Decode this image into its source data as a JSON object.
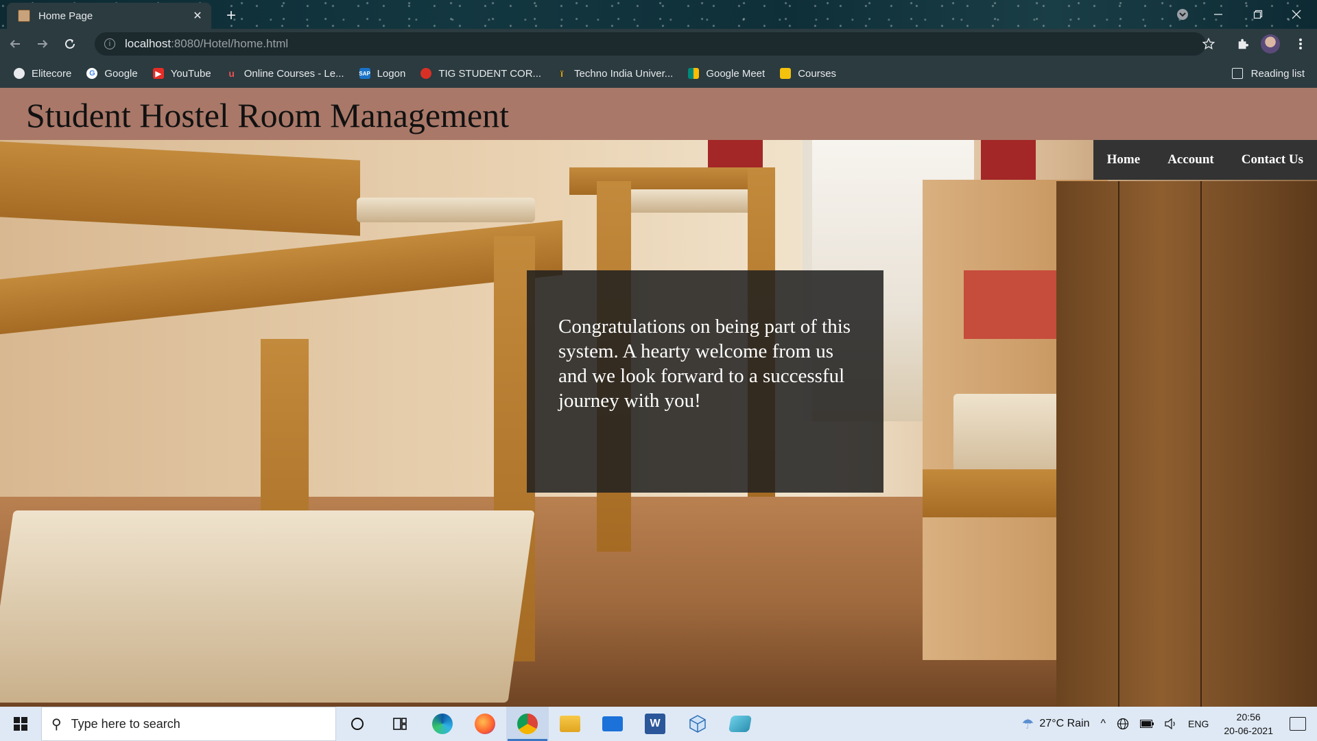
{
  "browser": {
    "tab_title": "Home Page",
    "tab_close": "✕",
    "new_tab": "+",
    "url_host": "localhost",
    "url_path": ":8080/Hotel/home.html",
    "bookmarks": [
      {
        "label": "Elitecore",
        "icon": "globe-icon",
        "color": "#e8eaed"
      },
      {
        "label": "Google",
        "icon": "google-icon",
        "color": "#ffffff"
      },
      {
        "label": "YouTube",
        "icon": "youtube-icon",
        "color": "#e52d27"
      },
      {
        "label": "Online Courses - Le...",
        "icon": "udemy-icon",
        "color": "#ec5252"
      },
      {
        "label": "Logon",
        "icon": "sap-icon",
        "color": "#1a73c8"
      },
      {
        "label": "TIG STUDENT COR...",
        "icon": "tig-icon",
        "color": "#d93025"
      },
      {
        "label": "Techno India Univer...",
        "icon": "techno-icon",
        "color": "#f2a900"
      },
      {
        "label": "Google Meet",
        "icon": "meet-icon",
        "color": "#00897b"
      },
      {
        "label": "Courses",
        "icon": "courses-icon",
        "color": "#f4c20d"
      }
    ],
    "reading_list": "Reading list"
  },
  "page": {
    "title": "Student Hostel Room Management",
    "nav": [
      "Home",
      "Account",
      "Contact Us"
    ],
    "welcome": "Congratulations on being part of this system. A hearty welcome from us and we look forward to a successful journey with you!"
  },
  "taskbar": {
    "search_placeholder": "Type here to search",
    "weather": "27°C  Rain",
    "language": "ENG",
    "time": "20:56",
    "date": "20-06-2021"
  },
  "colors": {
    "header_bg": "#a97868",
    "nav_bg": "#333333",
    "overlay_bg": "rgba(30,30,30,0.85)"
  }
}
